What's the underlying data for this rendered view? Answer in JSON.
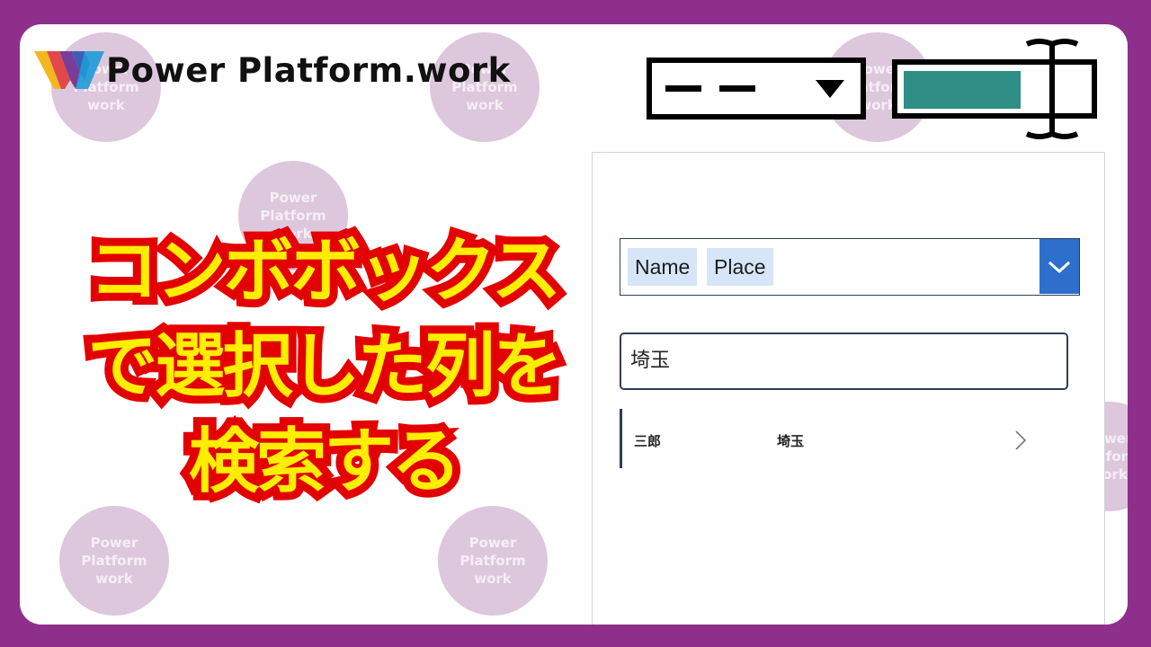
{
  "brand": {
    "name": "Power Platform.work",
    "watermark_lines": [
      "Power",
      "Platform",
      "work"
    ],
    "colors": {
      "frame": "#8e2f8c",
      "headline_fill": "#ffee00",
      "headline_stroke": "#e30000",
      "accent_blue": "#2d6fca",
      "teal": "#2f8e86"
    }
  },
  "headline": {
    "lines": [
      "コンボボックス",
      "で選択した列を",
      "検索する"
    ]
  },
  "icons": {
    "schematic": "combobox-and-textbox-schematic-icon",
    "logo": "power-platform-logo-icon",
    "dropdown": "chevron-down-icon",
    "row": "chevron-right-icon"
  },
  "app": {
    "combobox": {
      "selected": [
        "Name",
        "Place"
      ]
    },
    "search": {
      "value": "埼玉"
    },
    "gallery": {
      "rows": [
        {
          "name": "三郎",
          "place": "埼玉"
        }
      ]
    }
  }
}
